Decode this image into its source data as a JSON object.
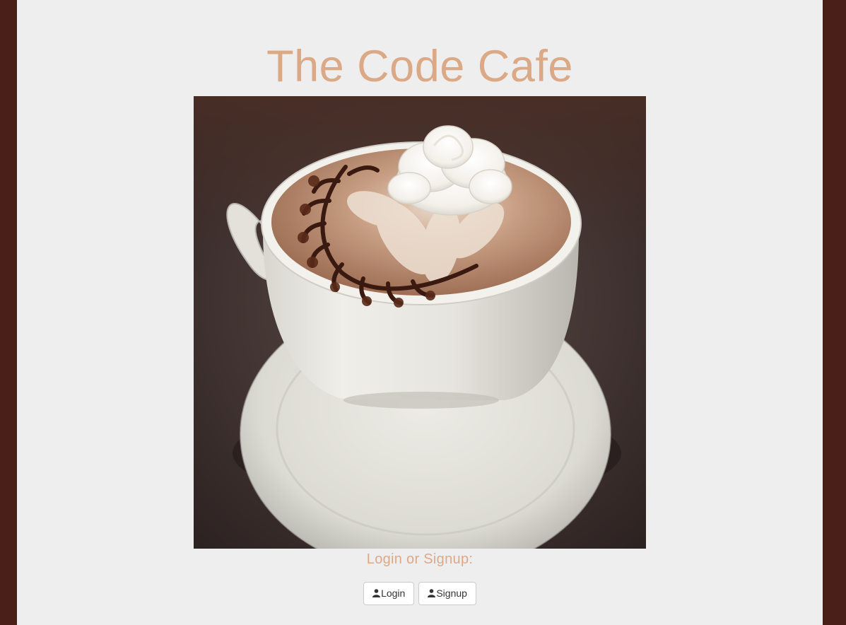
{
  "header": {
    "title": "The Code Cafe"
  },
  "hero": {
    "image_icon": "coffee-cup-latte-art-photo"
  },
  "auth": {
    "prompt": "Login or Signup:",
    "login_label": "Login",
    "signup_label": "Signup",
    "button_icon": "user-icon"
  },
  "colors": {
    "frame": "#4a1e19",
    "page": "#eeeeee",
    "accent": "#dca987"
  }
}
